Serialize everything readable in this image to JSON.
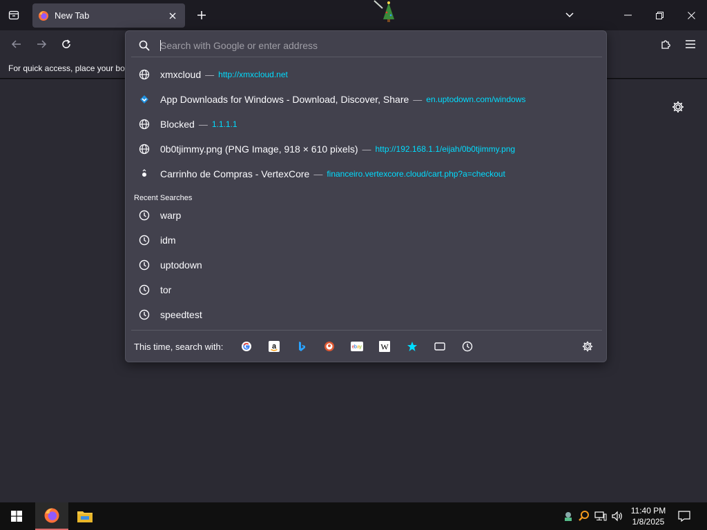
{
  "browser": {
    "tab": {
      "title": "New Tab"
    },
    "url": {
      "placeholder": "Search with Google or enter address"
    },
    "bookmarks_message": "For quick access, place your boo"
  },
  "suggestions": [
    {
      "title": "xmxcloud",
      "sep": "—",
      "url": "http://xmxcloud.net",
      "icon": "globe-icon"
    },
    {
      "title": "App Downloads for Windows - Download, Discover, Share",
      "sep": "—",
      "url": "en.uptodown.com/windows",
      "icon": "uptodown-icon"
    },
    {
      "title": "Blocked",
      "sep": "—",
      "url": "1.1.1.1",
      "icon": "globe-icon"
    },
    {
      "title": "0b0tjimmy.png (PNG Image, 918 × 610 pixels)",
      "sep": "—",
      "url": "http://192.168.1.1/eijah/0b0tjimmy.png",
      "icon": "globe-icon"
    },
    {
      "title": "Carrinho de Compras - VertexCore",
      "sep": "—",
      "url": "financeiro.vertexcore.cloud/cart.php?a=checkout",
      "icon": "vertexcore-icon"
    }
  ],
  "recent_header": "Recent Searches",
  "recent": [
    "warp",
    "idm",
    "uptodown",
    "tor",
    "speedtest"
  ],
  "search_with_label": "This time, search with:",
  "engines": [
    "google-icon",
    "amazon-icon",
    "bing-icon",
    "duckduckgo-icon",
    "ebay-icon",
    "wikipedia-icon",
    "bookmarks-star-icon",
    "tabs-icon",
    "history-icon"
  ],
  "taskbar": {
    "time": "11:40 PM",
    "date": "1/8/2025"
  },
  "colors": {
    "accent": "#00ddff",
    "panel": "#42414d",
    "toolbar": "#2b2a33",
    "tabbar": "#1c1b22"
  }
}
